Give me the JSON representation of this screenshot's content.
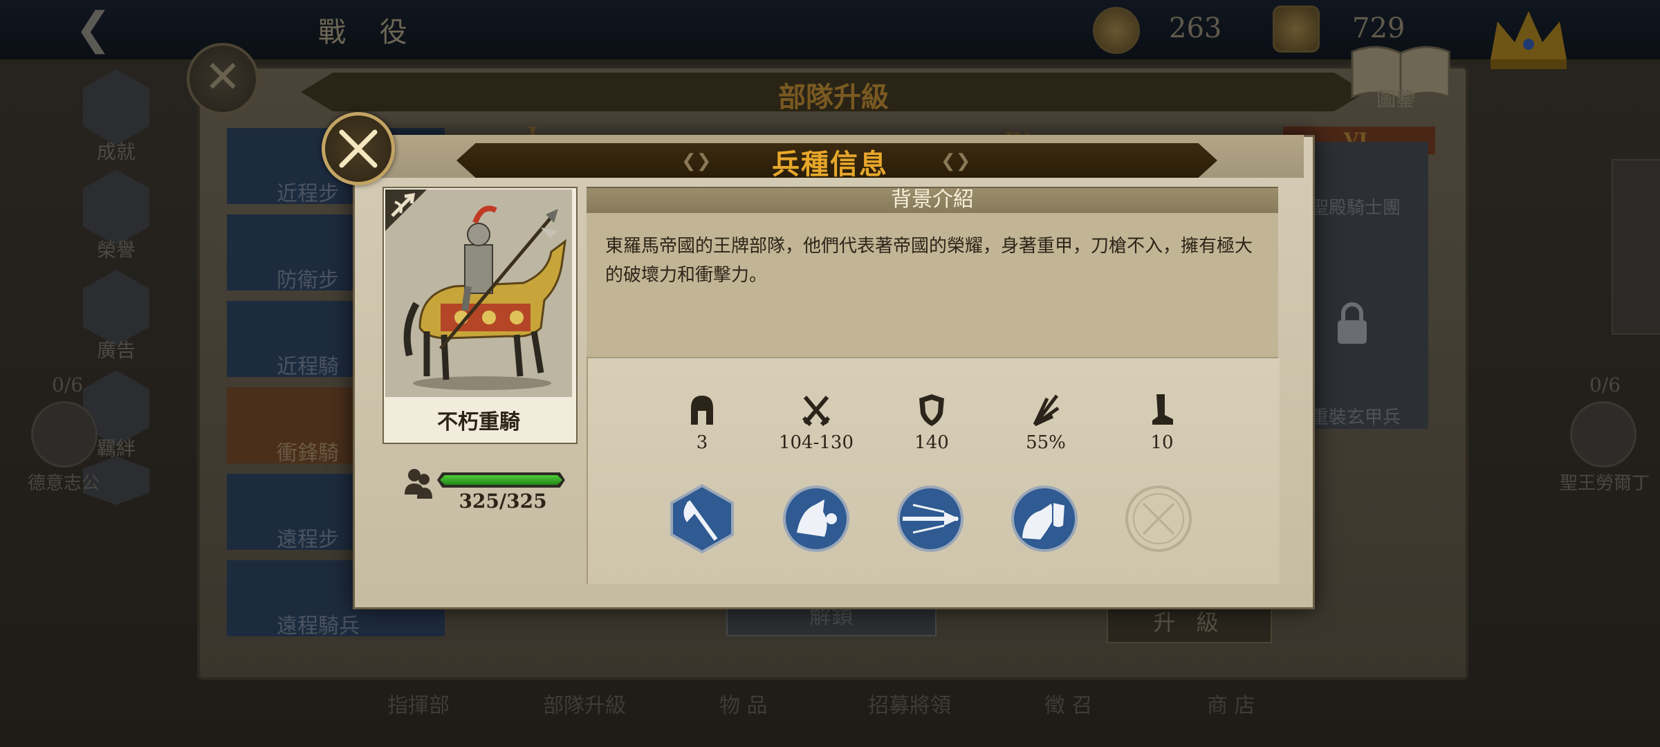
{
  "topbar": {
    "title": "戰 役",
    "coins": "263",
    "honor": "729"
  },
  "background": {
    "panel_title": "部隊升級",
    "book_label": "圖鑒",
    "sidebar": [
      {
        "label": "成就"
      },
      {
        "label": "榮譽"
      },
      {
        "label": "廣告"
      },
      {
        "label": "羈絆"
      }
    ],
    "tabs": [
      {
        "label": "近程步"
      },
      {
        "label": "防衛步"
      },
      {
        "label": "近程騎"
      },
      {
        "label": "衝鋒騎"
      },
      {
        "label": "遠程步"
      },
      {
        "label": "遠程騎兵"
      }
    ],
    "tier_label_vi": "VI",
    "tier_label_iv": "IV",
    "tier_label_i": "I",
    "right_card_1": "聖殿騎士團",
    "right_card_2": "重裝玄甲兵",
    "left_count": "0/6",
    "left_name": "德意志公",
    "right_count": "0/6",
    "right_name": "聖王勞爾丁",
    "unlock_label": "解鎖",
    "upgrade_label": "升 級",
    "bottom_nav": [
      "指揮部",
      "部隊升級",
      "物 品",
      "招募將領",
      "徵 召",
      "商 店"
    ]
  },
  "modal": {
    "title": "兵種信息",
    "unit_name": "不朽重騎",
    "hp": "325/325",
    "hp_fraction": 1.0,
    "intro_title": "背景介紹",
    "intro_text": "東羅馬帝國的王牌部隊，他們代表著帝國的榮耀，身著重甲，刀槍不入，擁有極大的破壞力和衝擊力。",
    "stats": [
      {
        "icon": "helmet-icon",
        "value": "3"
      },
      {
        "icon": "crossed-swords-icon",
        "value": "104-130"
      },
      {
        "icon": "shield-icon",
        "value": "140"
      },
      {
        "icon": "burst-icon",
        "value": "55%"
      },
      {
        "icon": "boot-icon",
        "value": "10"
      }
    ],
    "skills": [
      {
        "icon": "halberd-skill-icon",
        "locked": false
      },
      {
        "icon": "cavalry-charge-skill-icon",
        "locked": false
      },
      {
        "icon": "spear-thrust-skill-icon",
        "locked": false
      },
      {
        "icon": "armored-horse-skill-icon",
        "locked": false
      },
      {
        "icon": "empty-skill-slot-icon",
        "locked": true
      }
    ],
    "colors": {
      "title": "#e7a72b",
      "skill_blue": "#2f5a92",
      "hp_green": "#3aa82a"
    }
  }
}
